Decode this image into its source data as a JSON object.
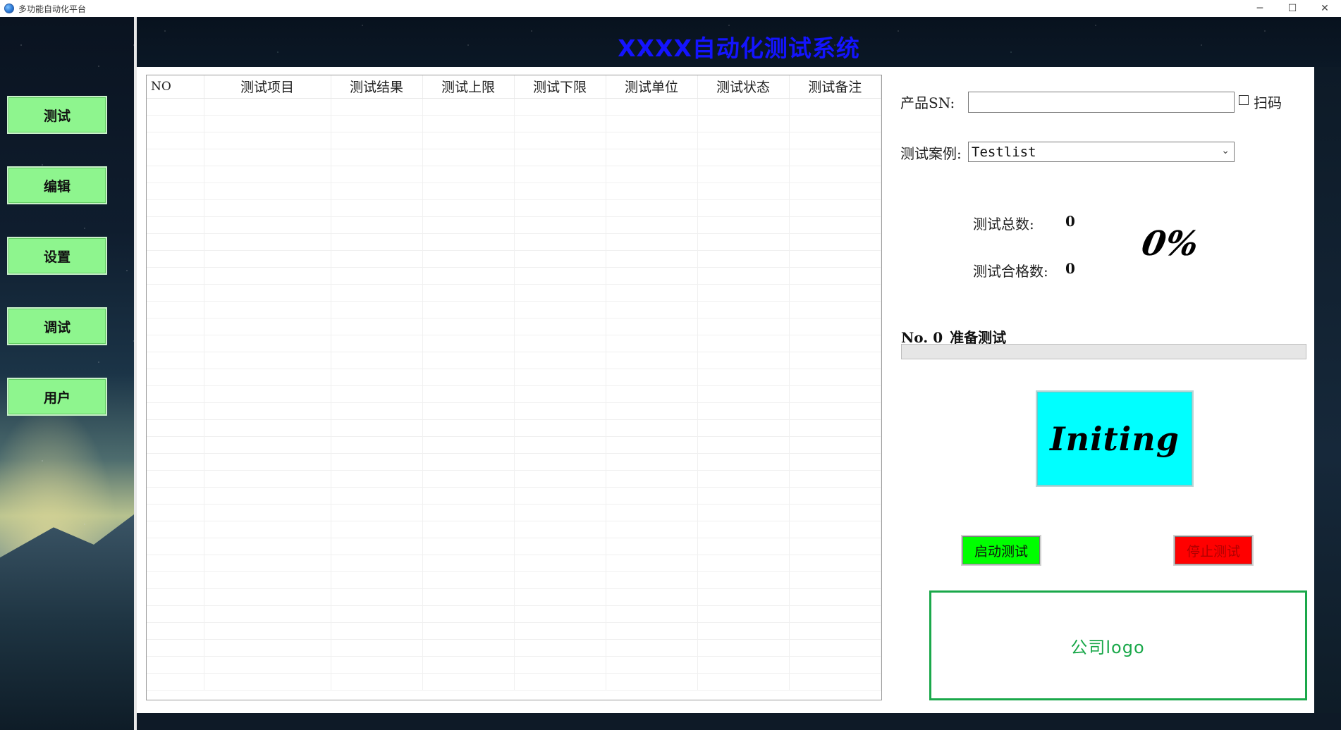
{
  "window": {
    "title": "多功能自动化平台",
    "controls": [
      "─",
      "☐",
      "✕"
    ]
  },
  "header": {
    "title": "XXXX自动化测试系统"
  },
  "sidebar": {
    "items": [
      {
        "label": "测试"
      },
      {
        "label": "编辑"
      },
      {
        "label": "设置"
      },
      {
        "label": "调试"
      },
      {
        "label": "用户"
      }
    ]
  },
  "table": {
    "columns": [
      "NO",
      "测试项目",
      "测试结果",
      "测试上限",
      "测试下限",
      "测试单位",
      "测试状态",
      "测试备注"
    ],
    "rows": []
  },
  "form": {
    "sn_label": "产品SN:",
    "sn_value": "",
    "scan_label": "扫码",
    "scan_checked": false,
    "case_label": "测试案例:",
    "case_value": "Testlist"
  },
  "stats": {
    "total_label": "测试总数:",
    "total_value": "0",
    "pass_label": "测试合格数:",
    "pass_value": "0",
    "percent": "0%"
  },
  "progress": {
    "title": "No. 0_准备测试",
    "value": 0
  },
  "status": {
    "text": "Initing",
    "color": "#00ffff"
  },
  "actions": {
    "start_label": "启动测试",
    "stop_label": "停止测试"
  },
  "logo": {
    "text": "公司logo",
    "border_color": "#1aa84a"
  },
  "colors": {
    "nav_button": "#8ef58e",
    "title_text": "#1414ff",
    "start_button": "#00ff00",
    "stop_button": "#ff0000"
  }
}
